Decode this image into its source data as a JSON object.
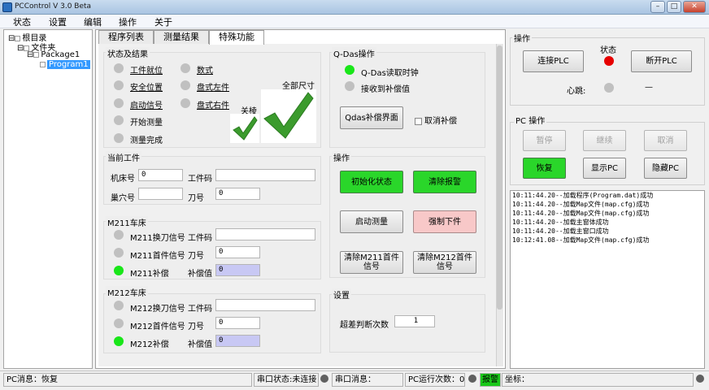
{
  "window": {
    "title": "PCControl V 3.0 Beta",
    "min": "–",
    "max": "□",
    "close": "✕"
  },
  "menu": [
    "状态",
    "设置",
    "编辑",
    "操作",
    "关于"
  ],
  "tree": {
    "root": "根目录",
    "folder": "文件夹",
    "package": "Package1",
    "program": "Program1"
  },
  "tabs": [
    "程序列表",
    "测量结果",
    "特殊功能"
  ],
  "status_group": {
    "title": "状态及结果",
    "col1": [
      "工件就位",
      "安全位置",
      "启动信号",
      "开始测量",
      "测量完成"
    ],
    "col2": [
      "数式",
      "盘式左件",
      "盘式右件"
    ],
    "close_label": "关棱",
    "full_label": "全部尺寸"
  },
  "current_workpiece": {
    "title": "当前工件",
    "machine_label": "机床号",
    "machine_value": "0",
    "code_label": "工件码",
    "code_value": "",
    "hole_label": "巢穴号",
    "hole_value": "",
    "tool_label": "刀号",
    "tool_value": "0"
  },
  "m211": {
    "title": "M211车床",
    "sig1": "M211换刀信号",
    "code_label": "工件码",
    "code_value": "",
    "sig2": "M211首件信号",
    "tool_label": "刀号",
    "tool_value": "0",
    "sig3": "M211补偿",
    "comp_label": "补偿值",
    "comp_value": "0"
  },
  "m212": {
    "title": "M212车床",
    "sig1": "M212换刀信号",
    "code_label": "工件码",
    "code_value": "",
    "sig2": "M212首件信号",
    "tool_label": "刀号",
    "tool_value": "0",
    "sig3": "M212补偿",
    "comp_label": "补偿值",
    "comp_value": "0"
  },
  "qdas": {
    "title": "Q-Das操作",
    "item1": "Q-Das读取时钟",
    "item2": "接收到补偿值",
    "btn": "Qdas补偿界面",
    "cancel": "取消补偿"
  },
  "ops": {
    "title": "操作",
    "init": "初始化状态",
    "clear_alarm": "清除报警",
    "start": "启动测量",
    "force": "强制下件",
    "clear211": "清除M211首件信号",
    "clear212": "清除M212首件信号"
  },
  "settings": {
    "title": "设置",
    "label": "超差判断次数",
    "value": "1"
  },
  "right": {
    "op_title": "操作",
    "state_label": "状态",
    "connect": "连接PLC",
    "disconnect": "断开PLC",
    "heartbeat": "心跳:",
    "heartbeat_value": "—",
    "pc_title": "PC 操作",
    "pause": "暂停",
    "resume": "继续",
    "cancel": "取消",
    "restore": "恢复",
    "show": "显示PC",
    "hide": "隐藏PC"
  },
  "log": [
    "10:11:44.20--加载程序(Program.dat)成功",
    "10:11:44.20--加载Map文件(map.cfg)成功",
    "10:11:44.20--加载Map文件(map.cfg)成功",
    "10:11:44.20--加载主窗体成功",
    "10:11:44.20--加载主窗口成功",
    "10:12:41.08--加载Map文件(map.cfg)成功"
  ],
  "statusbar": {
    "pc_msg": "PC消息：恢复",
    "serial_state": "串口状态:未连接",
    "serial_msg": "串口消息：",
    "run_count": "PC运行次数：0",
    "alarm": "报警",
    "coord": "坐标："
  },
  "colors": {
    "green": "#19e619",
    "red": "#e60000",
    "gray": "#c0c0c0",
    "btn_green": "#2ad62a",
    "btn_pink": "#f8c8c8"
  }
}
